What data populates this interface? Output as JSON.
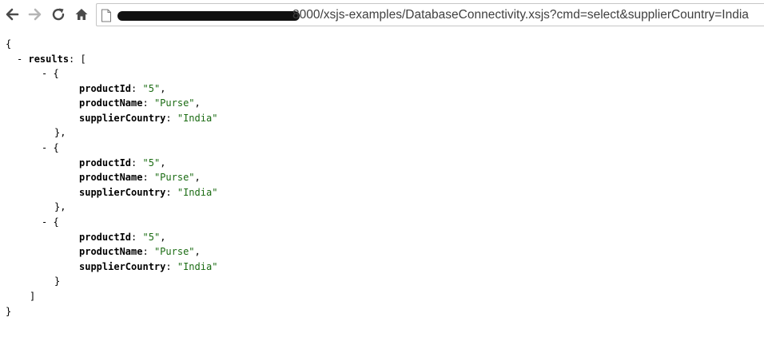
{
  "browser": {
    "url_visible": "8000/xsjs-examples/DatabaseConnectivity.xsjs?cmd=select&supplierCountry=India"
  },
  "json": {
    "open_brace": "{",
    "close_brace": "}",
    "results_key": "results",
    "open_bracket": "[",
    "close_bracket": "]",
    "collapse_symbol": "-",
    "items": [
      {
        "productId": "5",
        "productName": "Purse",
        "supplierCountry": "India"
      },
      {
        "productId": "5",
        "productName": "Purse",
        "supplierCountry": "India"
      },
      {
        "productId": "5",
        "productName": "Purse",
        "supplierCountry": "India"
      }
    ],
    "keys": {
      "productId": "productId",
      "productName": "productName",
      "supplierCountry": "supplierCountry"
    }
  },
  "colors": {
    "string_value": "#1a6b12",
    "key": "#000000"
  },
  "icons": {
    "back": "back-arrow-icon",
    "forward": "forward-arrow-icon",
    "reload": "reload-icon",
    "home": "home-icon",
    "page": "page-icon"
  }
}
